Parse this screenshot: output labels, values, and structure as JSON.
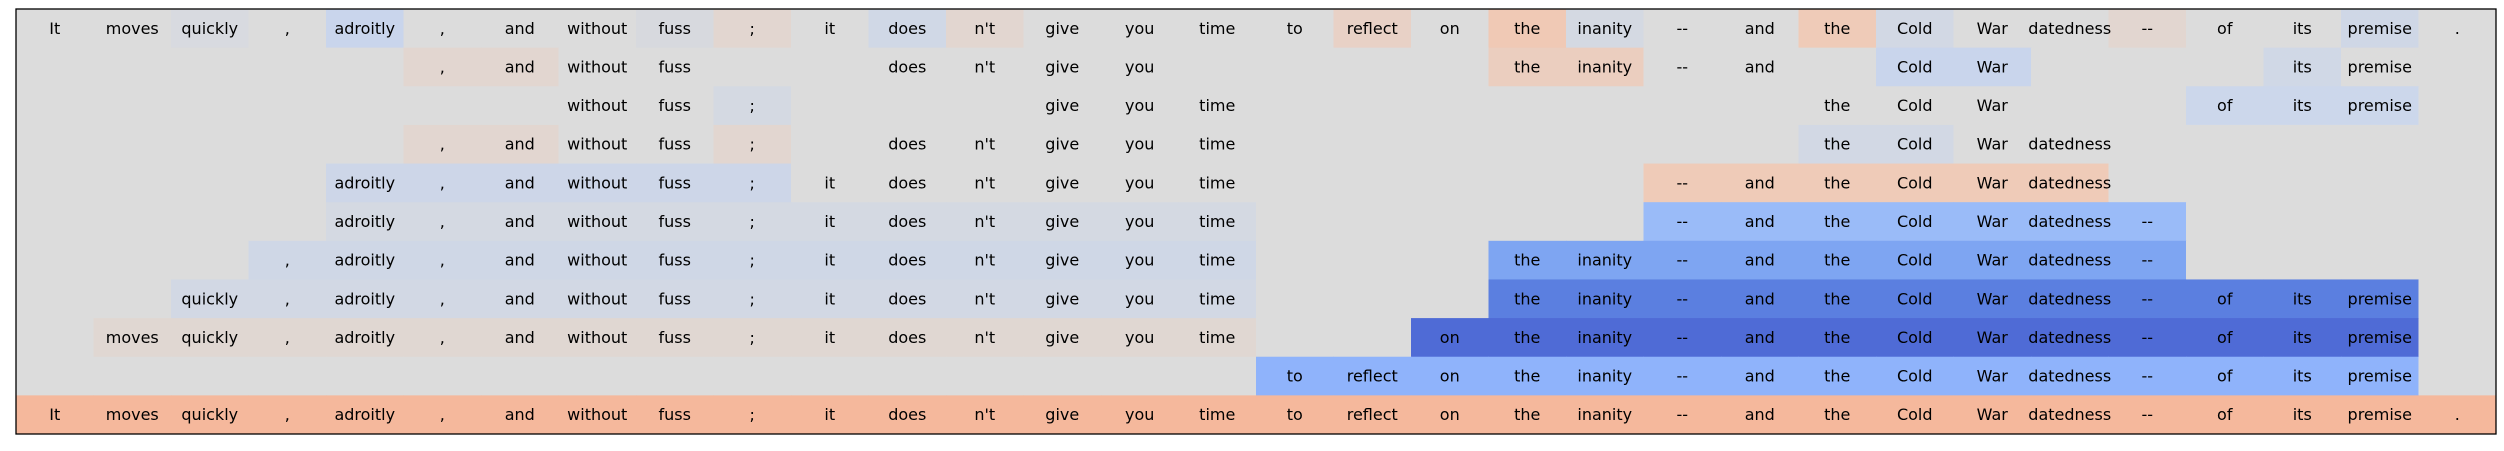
{
  "chart_data": {
    "type": "heatmap",
    "tokens": [
      "It",
      "moves",
      "quickly",
      ",",
      "adroitly",
      ",",
      "and",
      "without",
      "fuss",
      ";",
      "it",
      "does",
      "n't",
      "give",
      "you",
      "time",
      "to",
      "reflect",
      "on",
      "the",
      "inanity",
      "--",
      "and",
      "the",
      "Cold",
      "War",
      "datedness",
      "--",
      "of",
      "its",
      "premise",
      "."
    ],
    "rows": [
      {
        "show": [
          1,
          1,
          1,
          1,
          1,
          1,
          1,
          1,
          1,
          1,
          1,
          1,
          1,
          1,
          1,
          1,
          1,
          1,
          1,
          1,
          1,
          1,
          1,
          1,
          1,
          1,
          1,
          1,
          1,
          1,
          1,
          1
        ],
        "colors": [
          "#dcdcdc",
          "#dcdcdc",
          "#d8dae0",
          "#dcdcdc",
          "#c9d5ec",
          "#dcdcdc",
          "#dcdcdc",
          "#dcdcdc",
          "#d7d9de",
          "#e2d6d0",
          "#dcdcdc",
          "#d0d8e6",
          "#e2d6d0",
          "#dcdcdc",
          "#dcdcdc",
          "#dcdcdc",
          "#dcdcdc",
          "#e8d1c6",
          "#dcdcdc",
          "#f0c9b5",
          "#d4d9e2",
          "#dcdcdc",
          "#dcdcdc",
          "#efcbb8",
          "#d2d8e4",
          "#dcdcdc",
          "#dcdcdc",
          "#e2d6d0",
          "#dcdcdc",
          "#dcdcdc",
          "#cfd7e6",
          "#dcdcdc"
        ]
      },
      {
        "show": [
          0,
          0,
          0,
          0,
          0,
          1,
          1,
          1,
          1,
          0,
          0,
          1,
          1,
          1,
          1,
          0,
          0,
          0,
          0,
          1,
          1,
          1,
          1,
          0,
          1,
          1,
          0,
          0,
          0,
          1,
          1,
          0
        ],
        "colors": [
          "#dcdcdc",
          "#dcdcdc",
          "#dcdcdc",
          "#dcdcdc",
          "#dcdcdc",
          "#e2d6d0",
          "#e2d6d0",
          "#dcdcdc",
          "#dcdcdc",
          "#dcdcdc",
          "#dcdcdc",
          "#dcdcdc",
          "#dcdcdc",
          "#dcdcdc",
          "#dcdcdc",
          "#dcdcdc",
          "#dcdcdc",
          "#dcdcdc",
          "#dcdcdc",
          "#ebcebf",
          "#ebcebf",
          "#dcdcdc",
          "#dcdcdc",
          "#dcdcdc",
          "#c9d5ec",
          "#c9d5ec",
          "#dcdcdc",
          "#dcdcdc",
          "#dcdcdc",
          "#d0d8e6",
          "#dcdcdc",
          "#dcdcdc"
        ]
      },
      {
        "show": [
          0,
          0,
          0,
          0,
          0,
          0,
          0,
          1,
          1,
          1,
          0,
          0,
          0,
          1,
          1,
          1,
          0,
          0,
          0,
          0,
          0,
          0,
          0,
          1,
          1,
          1,
          0,
          0,
          1,
          1,
          1,
          0
        ],
        "colors": [
          "#dcdcdc",
          "#dcdcdc",
          "#dcdcdc",
          "#dcdcdc",
          "#dcdcdc",
          "#dcdcdc",
          "#dcdcdc",
          "#dcdcdc",
          "#dcdcdc",
          "#d4d9e2",
          "#dcdcdc",
          "#dcdcdc",
          "#dcdcdc",
          "#dcdcdc",
          "#dcdcdc",
          "#dcdcdc",
          "#dcdcdc",
          "#dcdcdc",
          "#dcdcdc",
          "#dcdcdc",
          "#dcdcdc",
          "#dcdcdc",
          "#dcdcdc",
          "#dcdcdc",
          "#dcdcdc",
          "#dcdcdc",
          "#dcdcdc",
          "#dcdcdc",
          "#ccd7eb",
          "#ccd7eb",
          "#ccd7eb",
          "#dcdcdc"
        ]
      },
      {
        "show": [
          0,
          0,
          0,
          0,
          0,
          1,
          1,
          1,
          1,
          1,
          0,
          1,
          1,
          1,
          1,
          1,
          0,
          0,
          0,
          0,
          0,
          0,
          0,
          1,
          1,
          1,
          1,
          0,
          0,
          0,
          0,
          0
        ],
        "colors": [
          "#dcdcdc",
          "#dcdcdc",
          "#dcdcdc",
          "#dcdcdc",
          "#dcdcdc",
          "#e2d6d0",
          "#e2d6d0",
          "#dcdcdc",
          "#dcdcdc",
          "#e2d6d0",
          "#dcdcdc",
          "#dcdcdc",
          "#dcdcdc",
          "#dcdcdc",
          "#dcdcdc",
          "#dcdcdc",
          "#dcdcdc",
          "#dcdcdc",
          "#dcdcdc",
          "#dcdcdc",
          "#dcdcdc",
          "#dcdcdc",
          "#dcdcdc",
          "#d2d8e4",
          "#d2d8e4",
          "#dcdcdc",
          "#dcdcdc",
          "#dcdcdc",
          "#dcdcdc",
          "#dcdcdc",
          "#dcdcdc",
          "#dcdcdc"
        ]
      },
      {
        "show": [
          0,
          0,
          0,
          0,
          1,
          1,
          1,
          1,
          1,
          1,
          1,
          1,
          1,
          1,
          1,
          1,
          0,
          0,
          0,
          0,
          0,
          1,
          1,
          1,
          1,
          1,
          1,
          0,
          0,
          0,
          0,
          0
        ],
        "colors": [
          "#dcdcdc",
          "#dcdcdc",
          "#dcdcdc",
          "#dcdcdc",
          "#cdd6e8",
          "#cdd6e8",
          "#cdd6e8",
          "#cdd6e8",
          "#cdd6e8",
          "#cdd6e8",
          "#dcdcdc",
          "#dcdcdc",
          "#dcdcdc",
          "#dcdcdc",
          "#dcdcdc",
          "#dcdcdc",
          "#dcdcdc",
          "#dcdcdc",
          "#dcdcdc",
          "#dcdcdc",
          "#dcdcdc",
          "#efcbb8",
          "#efcbb8",
          "#efcbb8",
          "#efcbb8",
          "#efcbb8",
          "#efcbb8",
          "#dcdcdc",
          "#dcdcdc",
          "#dcdcdc",
          "#dcdcdc",
          "#dcdcdc"
        ]
      },
      {
        "show": [
          0,
          0,
          0,
          0,
          1,
          1,
          1,
          1,
          1,
          1,
          1,
          1,
          1,
          1,
          1,
          1,
          0,
          0,
          0,
          0,
          0,
          1,
          1,
          1,
          1,
          1,
          1,
          1,
          0,
          0,
          0,
          0
        ],
        "colors": [
          "#dcdcdc",
          "#dcdcdc",
          "#dcdcdc",
          "#dcdcdc",
          "#d4d9e2",
          "#d4d9e2",
          "#d4d9e2",
          "#d4d9e2",
          "#d4d9e2",
          "#d4d9e2",
          "#d4d9e2",
          "#d4d9e2",
          "#d4d9e2",
          "#d4d9e2",
          "#d4d9e2",
          "#d4d9e2",
          "#dcdcdc",
          "#dcdcdc",
          "#dcdcdc",
          "#dcdcdc",
          "#dcdcdc",
          "#9abbf8",
          "#9abbf8",
          "#9abbf8",
          "#9abbf8",
          "#9abbf8",
          "#9abbf8",
          "#9abbf8",
          "#dcdcdc",
          "#dcdcdc",
          "#dcdcdc",
          "#dcdcdc"
        ]
      },
      {
        "show": [
          0,
          0,
          0,
          1,
          1,
          1,
          1,
          1,
          1,
          1,
          1,
          1,
          1,
          1,
          1,
          1,
          0,
          0,
          0,
          1,
          1,
          1,
          1,
          1,
          1,
          1,
          1,
          1,
          0,
          0,
          0,
          0
        ],
        "colors": [
          "#dcdcdc",
          "#dcdcdc",
          "#dcdcdc",
          "#cfd7e6",
          "#cfd7e6",
          "#cfd7e6",
          "#cfd7e6",
          "#cfd7e6",
          "#cfd7e6",
          "#cfd7e6",
          "#cfd7e6",
          "#cfd7e6",
          "#cfd7e6",
          "#cfd7e6",
          "#cfd7e6",
          "#cfd7e6",
          "#dcdcdc",
          "#dcdcdc",
          "#dcdcdc",
          "#7ea5f2",
          "#7ea5f2",
          "#7ea5f2",
          "#7ea5f2",
          "#7ea5f2",
          "#7ea5f2",
          "#7ea5f2",
          "#7ea5f2",
          "#7ea5f2",
          "#dcdcdc",
          "#dcdcdc",
          "#dcdcdc",
          "#dcdcdc"
        ]
      },
      {
        "show": [
          0,
          0,
          1,
          1,
          1,
          1,
          1,
          1,
          1,
          1,
          1,
          1,
          1,
          1,
          1,
          1,
          0,
          0,
          0,
          1,
          1,
          1,
          1,
          1,
          1,
          1,
          1,
          1,
          1,
          1,
          1,
          0
        ],
        "colors": [
          "#dcdcdc",
          "#dcdcdc",
          "#d2d8e4",
          "#d2d8e4",
          "#d2d8e4",
          "#d2d8e4",
          "#d2d8e4",
          "#d2d8e4",
          "#d2d8e4",
          "#d2d8e4",
          "#d2d8e4",
          "#d2d8e4",
          "#d2d8e4",
          "#d2d8e4",
          "#d2d8e4",
          "#d2d8e4",
          "#dcdcdc",
          "#dcdcdc",
          "#dcdcdc",
          "#5b7fe0",
          "#5b7fe0",
          "#5b7fe0",
          "#5b7fe0",
          "#5b7fe0",
          "#5b7fe0",
          "#5b7fe0",
          "#5b7fe0",
          "#5b7fe0",
          "#5b7fe0",
          "#5b7fe0",
          "#5b7fe0",
          "#dcdcdc"
        ]
      },
      {
        "show": [
          0,
          1,
          1,
          1,
          1,
          1,
          1,
          1,
          1,
          1,
          1,
          1,
          1,
          1,
          1,
          1,
          0,
          0,
          1,
          1,
          1,
          1,
          1,
          1,
          1,
          1,
          1,
          1,
          1,
          1,
          1,
          0
        ],
        "colors": [
          "#dcdcdc",
          "#e0d7d2",
          "#e0d7d2",
          "#e0d7d2",
          "#e0d7d2",
          "#e0d7d2",
          "#e0d7d2",
          "#e0d7d2",
          "#e0d7d2",
          "#e0d7d2",
          "#e0d7d2",
          "#e0d7d2",
          "#e0d7d2",
          "#e0d7d2",
          "#e0d7d2",
          "#e0d7d2",
          "#dcdcdc",
          "#dcdcdc",
          "#4f6bd6",
          "#4f6bd6",
          "#4f6bd6",
          "#4f6bd6",
          "#4f6bd6",
          "#4f6bd6",
          "#4f6bd6",
          "#4f6bd6",
          "#4f6bd6",
          "#4f6bd6",
          "#4f6bd6",
          "#4f6bd6",
          "#4f6bd6",
          "#dcdcdc"
        ]
      },
      {
        "show": [
          0,
          0,
          0,
          0,
          0,
          0,
          0,
          0,
          0,
          0,
          0,
          0,
          0,
          0,
          0,
          0,
          1,
          1,
          1,
          1,
          1,
          1,
          1,
          1,
          1,
          1,
          1,
          1,
          1,
          1,
          1,
          0
        ],
        "colors": [
          "#dcdcdc",
          "#dcdcdc",
          "#dcdcdc",
          "#dcdcdc",
          "#dcdcdc",
          "#dcdcdc",
          "#dcdcdc",
          "#dcdcdc",
          "#dcdcdc",
          "#dcdcdc",
          "#dcdcdc",
          "#dcdcdc",
          "#dcdcdc",
          "#dcdcdc",
          "#dcdcdc",
          "#dcdcdc",
          "#8fb3fb",
          "#8fb3fb",
          "#8fb3fb",
          "#8fb3fb",
          "#8fb3fb",
          "#8fb3fb",
          "#8fb3fb",
          "#8fb3fb",
          "#8fb3fb",
          "#8fb3fb",
          "#8fb3fb",
          "#8fb3fb",
          "#8fb3fb",
          "#8fb3fb",
          "#8fb3fb",
          "#dcdcdc"
        ]
      },
      {
        "show": [
          1,
          1,
          1,
          1,
          1,
          1,
          1,
          1,
          1,
          1,
          1,
          1,
          1,
          1,
          1,
          1,
          1,
          1,
          1,
          1,
          1,
          1,
          1,
          1,
          1,
          1,
          1,
          1,
          1,
          1,
          1,
          1
        ],
        "colors": [
          "#f5b89c",
          "#f5b89c",
          "#f5b89c",
          "#f5b89c",
          "#f5b89c",
          "#f5b89c",
          "#f5b89c",
          "#f5b89c",
          "#f5b89c",
          "#f5b89c",
          "#f5b89c",
          "#f5b89c",
          "#f5b89c",
          "#f5b89c",
          "#f5b89c",
          "#f5b89c",
          "#f5b89c",
          "#f5b89c",
          "#f5b89c",
          "#f5b89c",
          "#f5b89c",
          "#f5b89c",
          "#f5b89c",
          "#f5b89c",
          "#f5b89c",
          "#f5b89c",
          "#f5b89c",
          "#f5b89c",
          "#f5b89c",
          "#f5b89c",
          "#f5b89c",
          "#f5b89c"
        ]
      }
    ],
    "background_color": "#dcdcdc",
    "frame_color": "#000000",
    "title": "",
    "xlabel": "",
    "ylabel": ""
  }
}
